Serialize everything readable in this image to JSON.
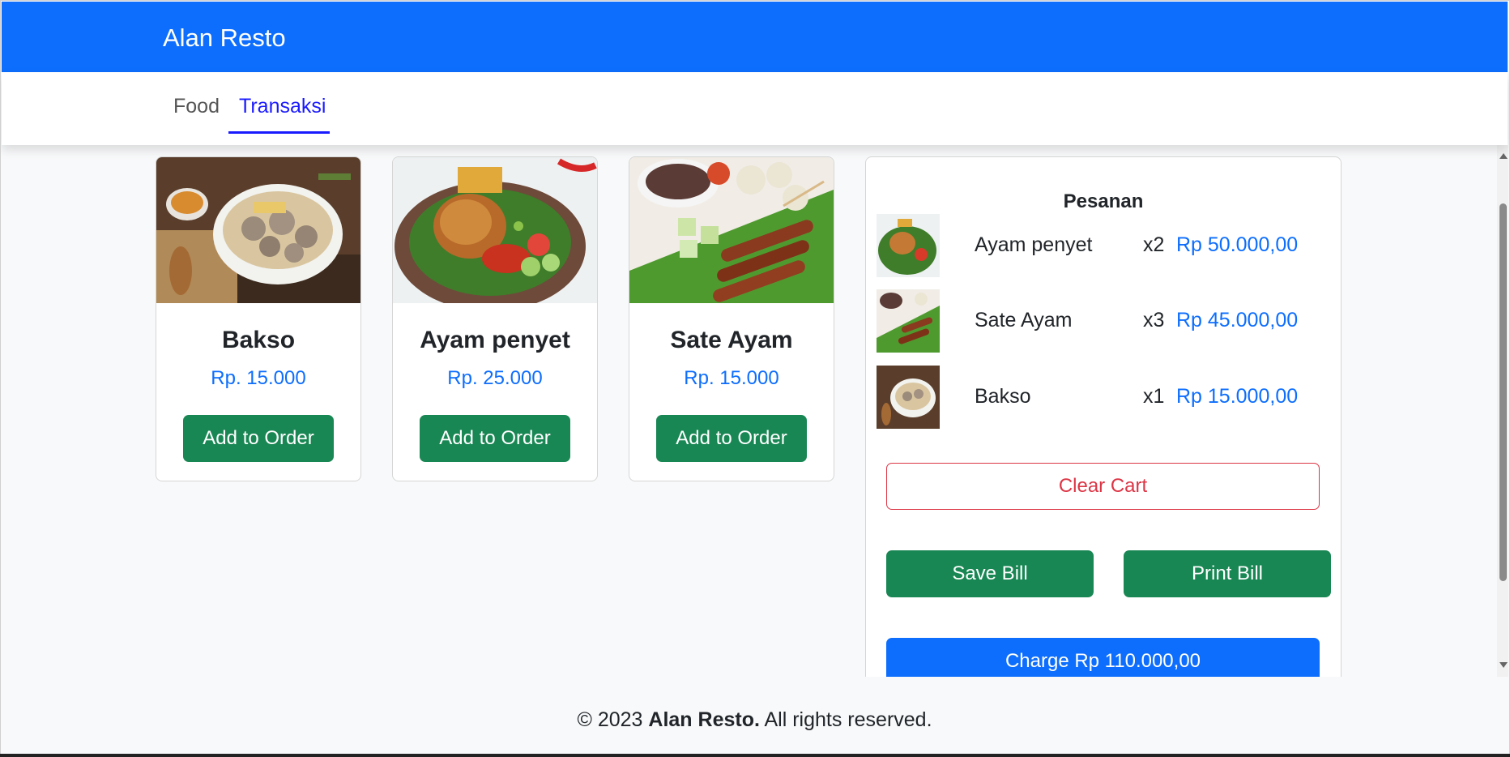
{
  "header": {
    "brand": "Alan Resto"
  },
  "nav": {
    "tabs": [
      "Food",
      "Transaksi"
    ],
    "active": "Transaksi"
  },
  "menu": {
    "items": [
      {
        "name": "Bakso",
        "price": "Rp. 15.000",
        "button": "Add to Order"
      },
      {
        "name": "Ayam penyet",
        "price": "Rp. 25.000",
        "button": "Add to Order"
      },
      {
        "name": "Sate Ayam",
        "price": "Rp. 15.000",
        "button": "Add to Order"
      }
    ]
  },
  "order": {
    "title": "Pesanan",
    "items": [
      {
        "name": "Ayam penyet",
        "qty": "x2",
        "subtotal": "Rp 50.000,00"
      },
      {
        "name": "Sate Ayam",
        "qty": "x3",
        "subtotal": "Rp 45.000,00"
      },
      {
        "name": "Bakso",
        "qty": "x1",
        "subtotal": "Rp 15.000,00"
      }
    ],
    "clear_label": "Clear Cart",
    "save_label": "Save Bill",
    "print_label": "Print Bill",
    "charge_label": "Charge Rp 110.000,00"
  },
  "footer": {
    "prefix": "© 2023 ",
    "brand": "Alan Resto.",
    "suffix": " All rights reserved."
  },
  "colors": {
    "primary": "#0d6efd",
    "success": "#198754",
    "danger": "#dc3545",
    "active_tab": "#1a1aff"
  }
}
